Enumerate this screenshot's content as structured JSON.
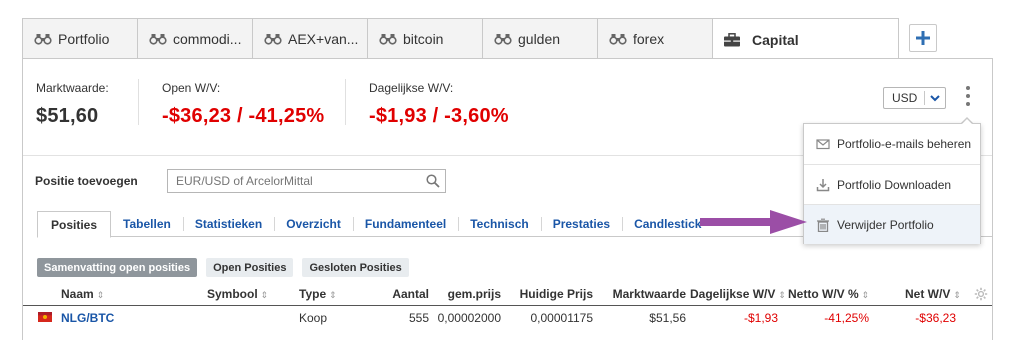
{
  "tabs": [
    {
      "label": "Portfolio",
      "icon": "binoculars-icon"
    },
    {
      "label": "commodi...",
      "icon": "binoculars-icon"
    },
    {
      "label": "AEX+van...",
      "icon": "binoculars-icon"
    },
    {
      "label": "bitcoin",
      "icon": "binoculars-icon"
    },
    {
      "label": "gulden",
      "icon": "binoculars-icon"
    },
    {
      "label": "forex",
      "icon": "binoculars-icon"
    },
    {
      "label": "Capital",
      "icon": "briefcase-icon",
      "active": true
    }
  ],
  "add_tab_label": "+",
  "summary": {
    "market_value_label": "Marktwaarde:",
    "market_value": "$51,60",
    "open_pl_label": "Open W/V:",
    "open_pl": "-$36,23 / -41,25%",
    "daily_pl_label": "Dagelijkse W/V:",
    "daily_pl": "-$1,93 / -3,60%"
  },
  "currency": {
    "selected": "USD"
  },
  "add_position": {
    "label": "Positie toevoegen",
    "placeholder": "EUR/USD of ArcelorMittal"
  },
  "subtabs": [
    "Posities",
    "Tabellen",
    "Statistieken",
    "Overzicht",
    "Fundamenteel",
    "Technisch",
    "Prestaties",
    "Candlestick"
  ],
  "pills": [
    "Samenvatting open posities",
    "Open Posities",
    "Gesloten Posities"
  ],
  "table": {
    "columns": [
      "Naam",
      "Symbool",
      "Type",
      "Aantal",
      "gem.prijs",
      "Huidige Prijs",
      "Marktwaarde",
      "Dagelijkse W/V",
      "Netto W/V %",
      "Net W/V"
    ],
    "rows": [
      {
        "naam": "NLG/BTC",
        "symbool": "",
        "type": "Koop",
        "aantal": "555",
        "gem_prijs": "0,00002000",
        "huidige_prijs": "0,00001175",
        "marktwaarde": "$51,56",
        "dagelijkse": "-$1,93",
        "netto_pct": "-41,25%",
        "net": "-$36,23"
      }
    ]
  },
  "menu": {
    "items": [
      {
        "label": "Portfolio-e-mails beheren",
        "icon": "envelope-icon"
      },
      {
        "label": "Portfolio Downloaden",
        "icon": "download-icon"
      },
      {
        "label": "Verwijder Portfolio",
        "icon": "trash-icon"
      }
    ]
  },
  "colors": {
    "negative": "#e00000",
    "link": "#1a56a7",
    "annotation_arrow": "#9b4ea6"
  }
}
